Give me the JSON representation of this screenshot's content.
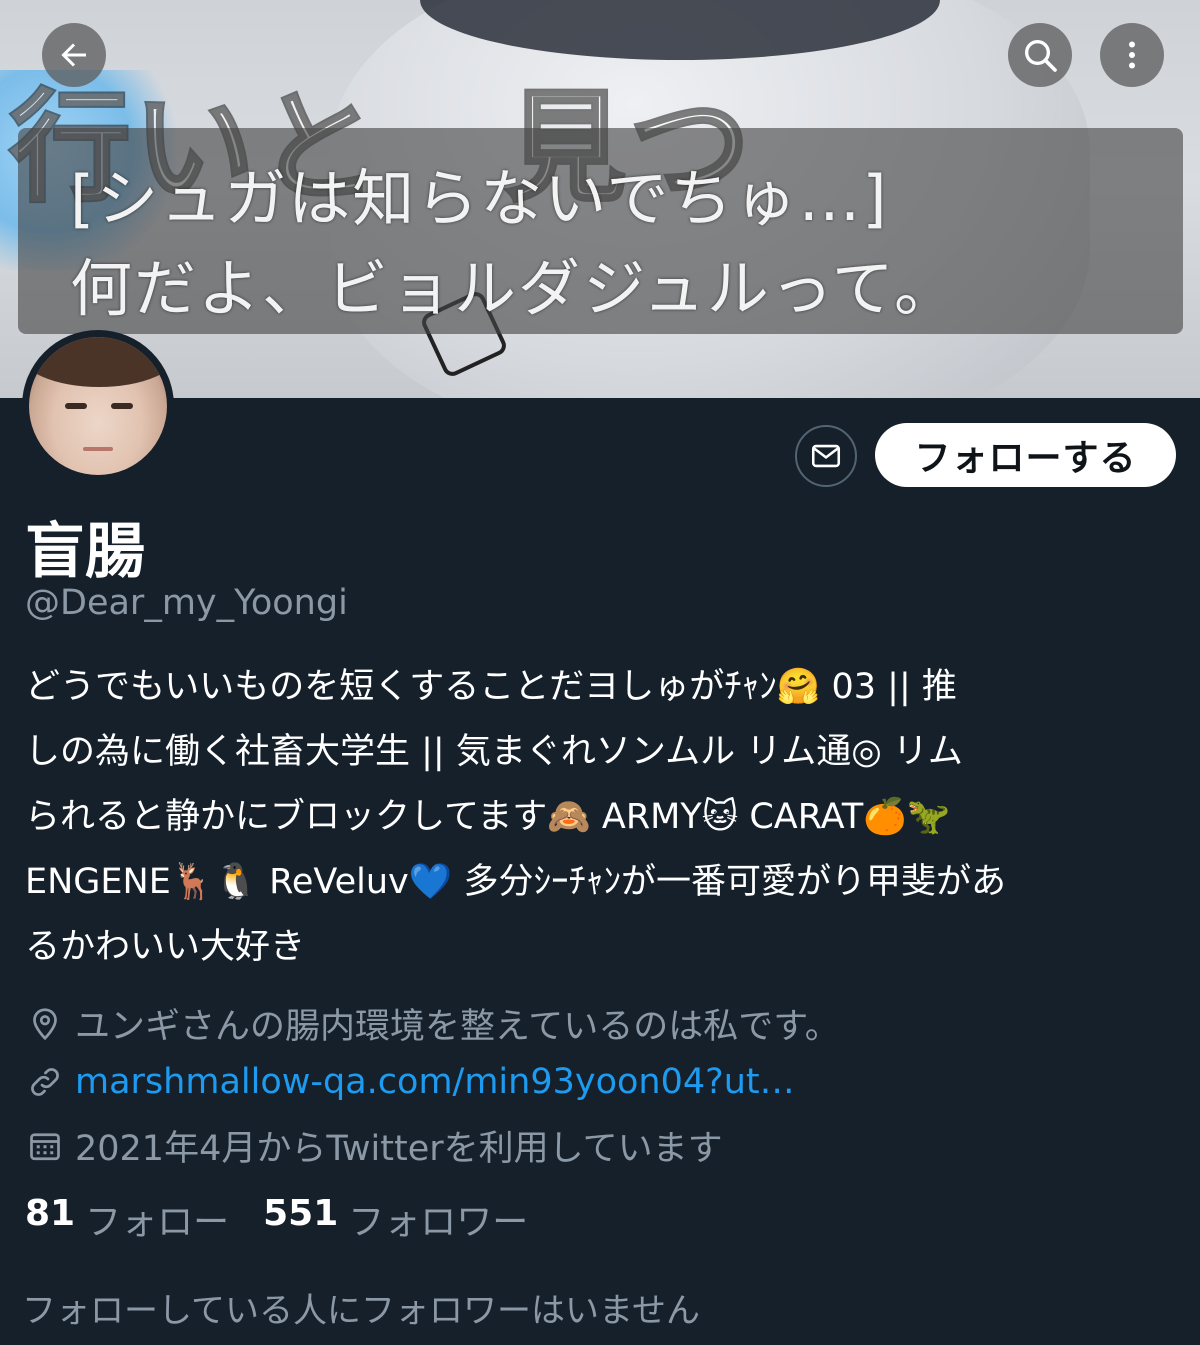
{
  "header": {
    "caption_line1": "[シュガは知らないでちゅ…]",
    "caption_line2": "何だよ、ビョルダジュルって。",
    "banner_logo_text": "行いと　見つ",
    "icons": {
      "back": "arrow-left-icon",
      "search": "search-icon",
      "more": "more-vertical-icon"
    }
  },
  "profile": {
    "display_name": "盲腸",
    "handle": "@Dear_my_Yoongi",
    "follow_button_label": "フォローする",
    "dm_icon": "envelope-icon",
    "bio_lines": [
      "どうでもいいものを短くすることだヨしゅがﾁｬﾝ🤗 03 || 推",
      "しの為に働く社畜大学生 || 気まぐれソンムル リム通◎ リム",
      "られると静かにブロックしてます🙈 ARMY🐱 CARAT🍊🦖",
      "ENGENE🦌🐧 ReVeluv💙 多分ｼｰﾁｬﾝが一番可愛がり甲斐があ",
      "るかわいい大好き"
    ],
    "location": "ユンギさんの腸内環境を整えているのは私です。",
    "link": "marshmallow-qa.com/min93yoon04?ut…",
    "joined": "2021年4月からTwitterを利用しています",
    "following_count": "81",
    "following_label": "フォロー",
    "followers_count": "551",
    "followers_label": "フォロワー",
    "no_followers_you_know": "フォローしている人にフォロワーはいません"
  },
  "colors": {
    "background": "#15202b",
    "secondary_text": "#8b98a5",
    "link": "#1d9bf0",
    "button_bg": "#ffffff"
  }
}
